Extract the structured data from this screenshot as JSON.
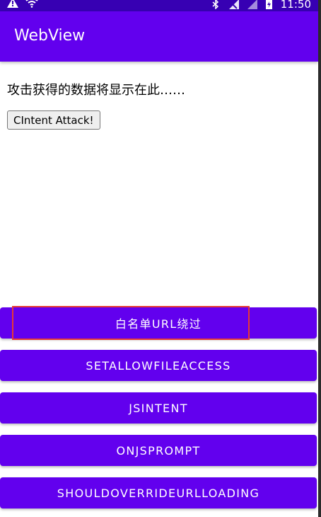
{
  "status_bar": {
    "time": "11:50",
    "icons": [
      "warning-icon",
      "wifi-icon",
      "bluetooth-icon",
      "signal-off-icon",
      "signal-bars-icon",
      "battery-icon"
    ]
  },
  "app_bar": {
    "title": "WebView"
  },
  "content": {
    "result_text": "攻击获得的数据将显示在此……",
    "intent_button_label": "CIntent Attack!"
  },
  "buttons": [
    {
      "label": "白名单URL绕过",
      "highlighted": true
    },
    {
      "label": "SETALLOWFILEACCESS"
    },
    {
      "label": "JSINTENT"
    },
    {
      "label": "ONJSPROMPT"
    },
    {
      "label": "SHOULDOVERRIDEURLLOADING"
    }
  ],
  "colors": {
    "primary": "#6200ee",
    "primary_dark": "#3700b3",
    "highlight": "#e53935"
  }
}
